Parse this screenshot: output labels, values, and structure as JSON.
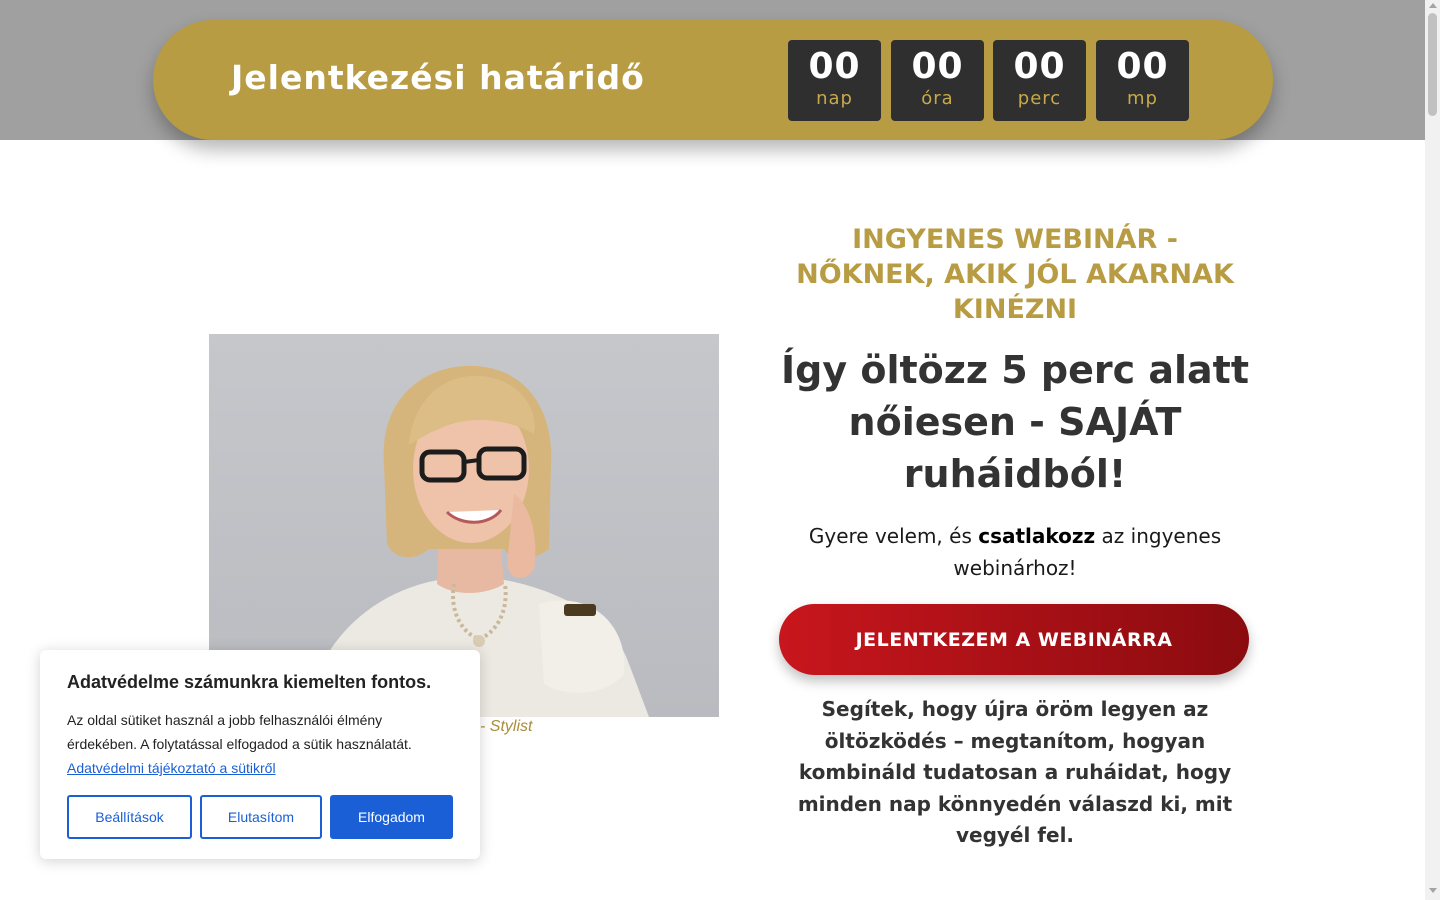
{
  "countdown": {
    "title": "Jelentkezési határidő",
    "units": [
      {
        "value": "00",
        "label": "nap"
      },
      {
        "value": "00",
        "label": "óra"
      },
      {
        "value": "00",
        "label": "perc"
      },
      {
        "value": "00",
        "label": "mp"
      }
    ]
  },
  "hero": {
    "photo_caption": "- Stylist",
    "eyebrow": "INGYENES WEBINÁR - NŐKNEK, AKIK JÓL AKARNAK KINÉZNI",
    "headline": "Így öltözz 5 perc alatt nőiesen - SAJÁT ruháidból!",
    "invite_before": "Gyere velem, és ",
    "invite_bold": "csatlakozz",
    "invite_after": " az ingyenes webinárhoz!",
    "cta_label": "JELENTKEZEM A WEBINÁRRA",
    "description": "Segítek, hogy újra öröm legyen az öltözködés – megtanítom, hogyan kombináld tudatosan a ruháidat, hogy minden nap könnyedén válaszd ki, mit vegyél fel."
  },
  "cookie_banner": {
    "title": "Adatvédelme számunkra kiemelten fontos.",
    "text": "Az oldal sütiket használ a jobb felhasználói élmény érdekében. A folytatással elfogadod a sütik használatát.",
    "link_label": "Adatvédelmi tájékoztató a sütikről",
    "settings_label": "Beállítások",
    "reject_label": "Elutasítom",
    "accept_label": "Elfogadom"
  },
  "colors": {
    "gold": "#b89c43",
    "dark_box": "#2f2f2f",
    "cta_red": "#c8161d",
    "cookie_blue": "#1a5fd6",
    "top_band_gray": "#a0a0a0"
  }
}
